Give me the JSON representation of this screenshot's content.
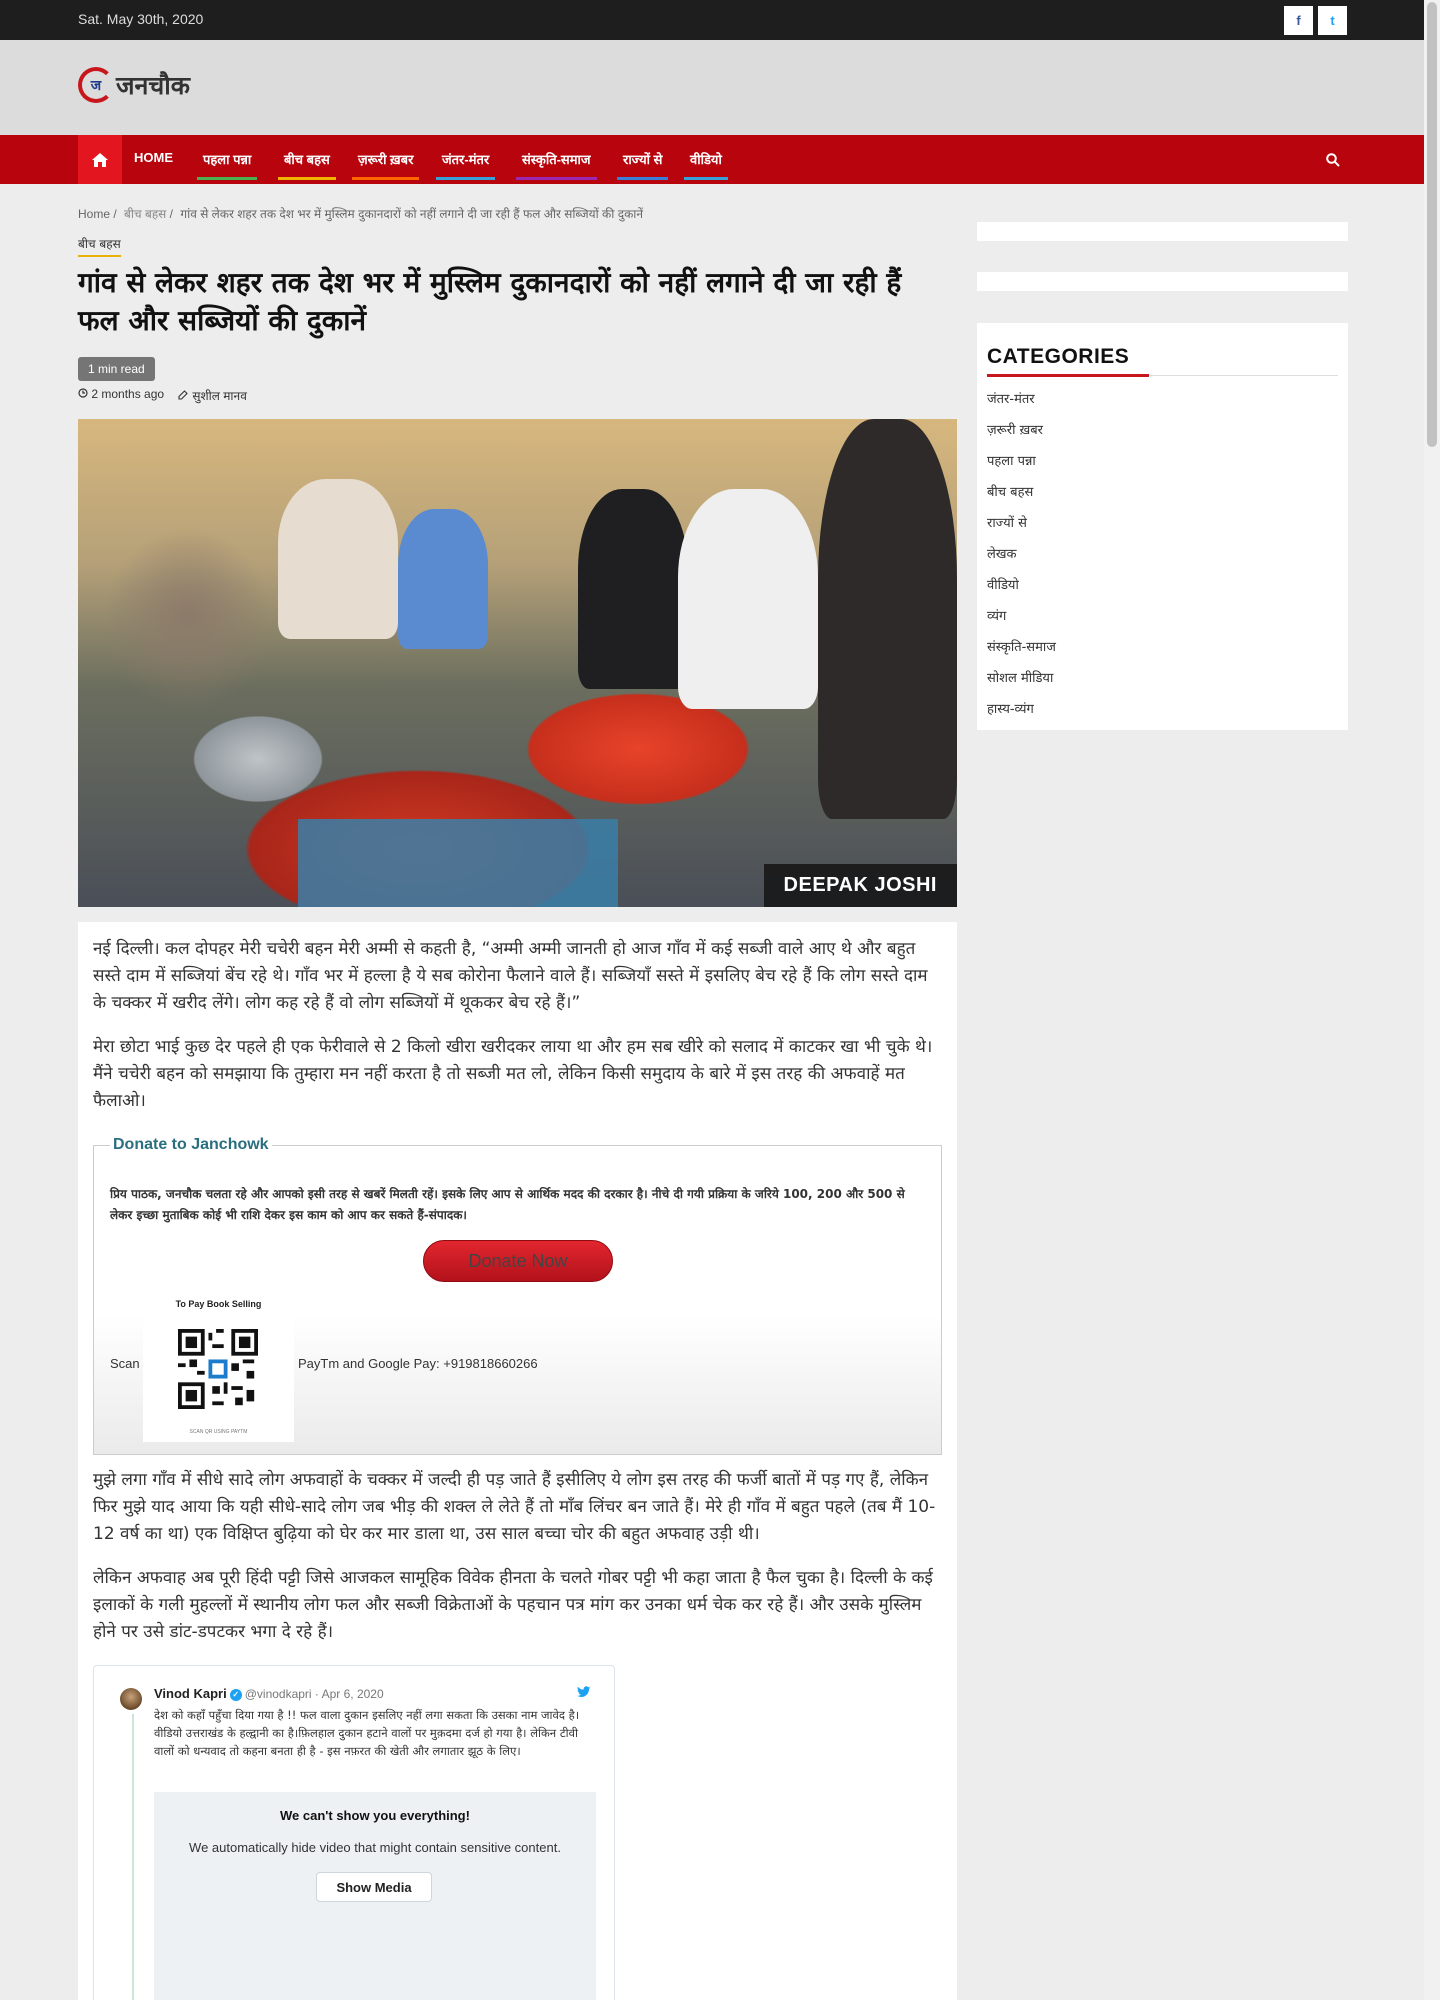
{
  "topbar": {
    "date": "Sat. May 30th, 2020",
    "social": [
      {
        "label": "f",
        "icon": "facebook-icon"
      },
      {
        "label": "t",
        "icon": "twitter-icon"
      }
    ]
  },
  "header": {
    "logo_mark": "ज",
    "logo_text": "जनचौक"
  },
  "nav": {
    "items": [
      {
        "label": "HOME",
        "accent": "#b8050d"
      },
      {
        "label": "पहला पन्ना",
        "accent": "#4caf50"
      },
      {
        "label": "बीच बहस",
        "accent": "#f0b400"
      },
      {
        "label": "ज़रूरी ख़बर",
        "accent": "#ff6600"
      },
      {
        "label": "जंतर-मंतर",
        "accent": "#3aa0d8"
      },
      {
        "label": "संस्कृति-समाज",
        "accent": "#9c27b0"
      },
      {
        "label": "राज्यों से",
        "accent": "#3a7fd8"
      },
      {
        "label": "वीडियो",
        "accent": "#3aa0d8"
      }
    ]
  },
  "breadcrumb": {
    "home": "Home",
    "category": "बीच बहस",
    "current": "गांव से लेकर शहर तक देश भर में मुस्लिम दुकानदारों को नहीं लगाने दी जा रही हैं फल और सब्जियों की दुकानें",
    "separator": "/"
  },
  "article": {
    "category": "बीच बहस",
    "title": "गांव से लेकर शहर तक देश भर में मुस्लिम दुकानदारों को नहीं लगाने दी जा रही हैं फल और सब्जियों की दुकानें",
    "read_time": "1 min read",
    "posted": "2 months ago",
    "author": "सुशील मानव",
    "image_caption": "DEEPAK JOSHI",
    "paragraphs": [
      "नई दिल्ली। कल दोपहर मेरी चचेरी बहन मेरी अम्मी से कहती है, “अम्मी अम्मी जानती हो आज गाँव में कई सब्जी वाले आए थे और बहुत सस्ते दाम में सब्जियां बेंच रहे थे। गाँव भर में हल्ला है ये सब कोरोना फैलाने वाले हैं। सब्जियाँ सस्ते में इसलिए बेच रहे हैं कि लोग सस्ते दाम के चक्कर में खरीद लेंगे। लोग कह रहे हैं वो लोग सब्जियों में थूककर बेच रहे हैं।”",
      "मेरा छोटा भाई कुछ देर पहले ही एक फेरीवाले से 2 किलो खीरा खरीदकर लाया था और हम सब खीरे को सलाद में काटकर खा भी चुके थे। मैंने चचेरी बहन को समझाया कि तुम्हारा मन नहीं करता है तो सब्जी मत लो, लेकिन किसी समुदाय के बारे में इस तरह की अफवाहें मत फैलाओ।",
      "मुझे लगा गाँव में सीधे सादे लोग अफवाहों के चक्कर में जल्दी ही पड़ जाते हैं इसीलिए ये लोग इस तरह की फर्जी बातों में पड़ गए हैं, लेकिन फिर मुझे याद आया कि यही सीधे-सादे लोग जब भीड़ की शक्ल ले लेते हैं तो माँब लिंचर बन जाते हैं। मेरे ही गाँव में बहुत पहले (तब मैं 10-12 वर्ष का था) एक विक्षिप्त बुढ़िया को घेर कर मार डाला था, उस साल बच्चा चोर की बहुत अफवाह उड़ी थी।",
      "लेकिन अफवाह अब पूरी हिंदी पट्टी जिसे आजकल सामूहिक विवेक हीनता के चलते गोबर पट्टी भी कहा जाता है फैल चुका है। दिल्ली के कई इलाकों के गली मुहल्लों में स्थानीय लोग फल और सब्जी विक्रेताओं के पहचान पत्र मांग कर उनका धर्म चेक कर रहे हैं। और उसके मुस्लिम होने पर उसे डांट-डपटकर भगा दे रहे हैं।"
    ]
  },
  "donate": {
    "legend": "Donate to Janchowk",
    "text": "प्रिय पाठक, जनचौक चलता रहे और आपको इसी तरह से खबरें मिलती रहें। इसके लिए आप से आर्थिक मदद की दरकार है। नीचे दी गयी प्रक्रिया के जरिये 100, 200 और 500 से लेकर इच्छा मुताबिक कोई भी राशि देकर इस काम को आप कर सकते हैं-संपादक।",
    "button": "Donate Now",
    "scan_label": "Scan",
    "qr_title": "To Pay Book Selling",
    "qr_footer": "SCAN QR USING PAYTM",
    "pay_text": "PayTm and Google Pay: +919818660266"
  },
  "tweet": {
    "name": "Vinod Kapri",
    "verified": "✓",
    "handle": "@vinodkapri · Apr 6, 2020",
    "text": "देश को कहाँ पहुँचा दिया गया है !! फल वाला दुकान इसलिए नहीं लगा सकता कि उसका नाम जावेद है। वीडियो उत्तराखंड के हल्द्वानी का है।फ़िलहाल दुकान हटाने वालों पर मुक़दमा दर्ज हो गया है। लेकिन टीवी वालों को धन्यवाद तो कहना बनता ही है - इस नफ़रत की खेती और लगातार झूठ के लिए।",
    "sensitive_title": "We can't show you everything!",
    "sensitive_desc": "We automatically hide video that might contain sensitive content.",
    "show_media": "Show Media"
  },
  "sidebar": {
    "categories_heading": "CATEGORIES",
    "categories": [
      "जंतर-मंतर",
      "ज़रूरी ख़बर",
      "पहला पन्ना",
      "बीच बहस",
      "राज्यों से",
      "लेखक",
      "वीडियो",
      "व्यंग",
      "संस्कृति-समाज",
      "सोशल मीडिया",
      "हास्य-व्यंग"
    ]
  },
  "colors": {
    "brand_red": "#b8050d",
    "nav_home_active": "#e3151f",
    "donate_accent": "#2a6f7f"
  }
}
